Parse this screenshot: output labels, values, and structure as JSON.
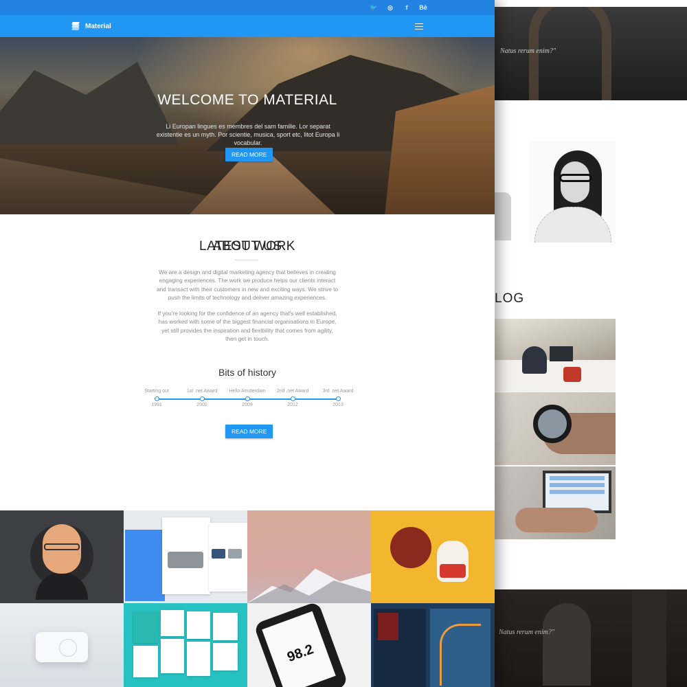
{
  "colors": {
    "primary": "#2196f3",
    "topbar": "#2383e2",
    "text_muted": "#8a8a8a",
    "heading": "#222222"
  },
  "topbar": {
    "social": [
      {
        "icon": "twitter-icon",
        "glyph": "🐦"
      },
      {
        "icon": "dribbble-icon",
        "glyph": "◎"
      },
      {
        "icon": "facebook-icon",
        "glyph": "f"
      },
      {
        "icon": "behance-icon",
        "glyph": "Bē"
      }
    ]
  },
  "navbar": {
    "brand": "Material",
    "brand_icon": "layers-icon",
    "menu_icon": "hamburger-menu-icon"
  },
  "hero": {
    "title": "WELCOME TO MATERIAL",
    "text": "Li Europan lingues es membres del sam familie. Lor separat existentie es un myth. Por scientie, musica, sport etc, litot Europa li vocabular.",
    "button": "READ MORE"
  },
  "about": {
    "title": "ABOUT US",
    "paragraph1": "We are a design and digital marketing agency that believes in creating engaging experiences. The work we produce helps our clients interact and transact with their customers in new and exciting ways. We strive to push the limits of technology and deliver amazing experiences.",
    "paragraph2": "If you're looking for the confidence of an agency that's well established, has worked with some of the biggest financial organisations in Europe, yet still provides the inspiration and flexibility that comes from agility, then get in touch.",
    "history_title": "Bits of history",
    "milestones": [
      {
        "label": "Starting out",
        "year": "1991"
      },
      {
        "label": "1st .net Award",
        "year": "2001"
      },
      {
        "label": "Hello Amsterdam",
        "year": "2009"
      },
      {
        "label": "2nd .net Award",
        "year": "2012"
      },
      {
        "label": "3rd .net Award",
        "year": "2013"
      }
    ],
    "button": "READ MORE"
  },
  "work": {
    "title": "LATEST WORK",
    "tiles": [
      {
        "name": "work-tile-portrait-illustration"
      },
      {
        "name": "work-tile-furniture-app"
      },
      {
        "name": "work-tile-lowpoly-mountains"
      },
      {
        "name": "work-tile-hen-and-cat"
      },
      {
        "name": "work-tile-white-radio"
      },
      {
        "name": "work-tile-stationery-mockups"
      },
      {
        "name": "work-tile-radio-app-phone",
        "text": "98.2"
      },
      {
        "name": "work-tile-movie-app"
      }
    ]
  },
  "back_page": {
    "hero_quote": "Natus rerum enim?\"",
    "blog_title": "LOG",
    "footer_quote": "Natus rerum enim?\""
  }
}
